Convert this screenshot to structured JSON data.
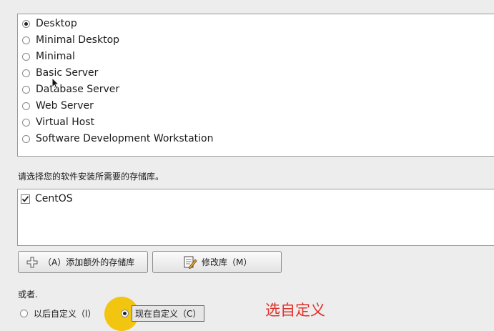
{
  "install_types": [
    {
      "label": "Desktop",
      "selected": true
    },
    {
      "label": "Minimal Desktop",
      "selected": false
    },
    {
      "label": "Minimal",
      "selected": false
    },
    {
      "label": "Basic Server",
      "selected": false
    },
    {
      "label": "Database Server",
      "selected": false
    },
    {
      "label": "Web Server",
      "selected": false
    },
    {
      "label": "Virtual Host",
      "selected": false
    },
    {
      "label": "Software Development Workstation",
      "selected": false
    }
  ],
  "repo_section": {
    "label": "请选择您的软件安装所需要的存储库。",
    "repos": [
      {
        "label": "CentOS",
        "checked": true
      }
    ]
  },
  "buttons": {
    "add_repo": "（A）添加额外的存储库",
    "modify_repo": "修改库（M）"
  },
  "customize": {
    "or_label": "或者.",
    "later_label": "以后自定义（l）",
    "now_label": "现在自定义（C）",
    "selected": "now"
  },
  "annotation": {
    "text": "选自定义",
    "color": "#e0312a"
  },
  "colors": {
    "highlight_dot": "#f2c511"
  }
}
